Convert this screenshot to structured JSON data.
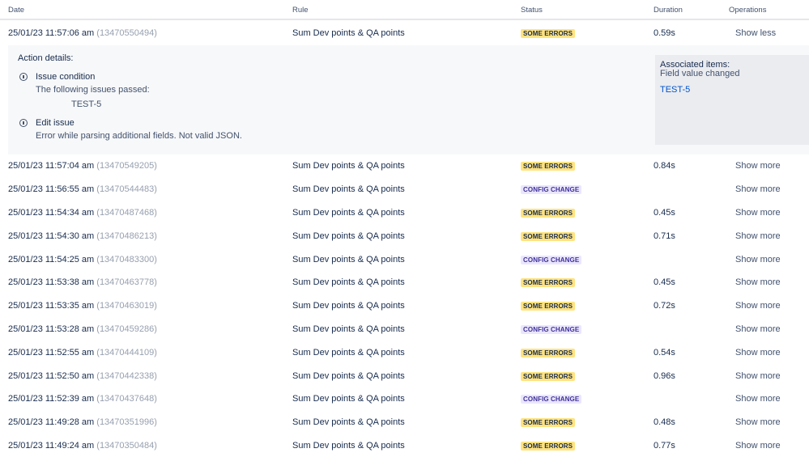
{
  "headers": {
    "date": "Date",
    "rule": "Rule",
    "status": "Status",
    "duration": "Duration",
    "operations": "Operations"
  },
  "expanded_row": {
    "date": "25/01/23 11:57:06 am",
    "id": "(13470550494)",
    "rule": "Sum Dev points & QA points",
    "status": "SOME ERRORS",
    "duration": "0.59s",
    "operation": "Show less"
  },
  "details": {
    "title": "Action details:",
    "actions": [
      {
        "name": "Issue condition",
        "description": "The following issues passed:",
        "issue": "TEST-5"
      },
      {
        "name": "Edit issue",
        "description": "Error while parsing additional fields. Not valid JSON."
      }
    ],
    "associated": {
      "heading": "Associated items:",
      "subheading": "Field value changed",
      "link": "TEST-5"
    }
  },
  "rows": [
    {
      "date": "25/01/23 11:57:04 am",
      "id": "(13470549205)",
      "rule": "Sum Dev points & QA points",
      "status": "SOME ERRORS",
      "status_type": "errors",
      "duration": "0.84s",
      "operation": "Show more"
    },
    {
      "date": "25/01/23 11:56:55 am",
      "id": "(13470544483)",
      "rule": "Sum Dev points & QA points",
      "status": "CONFIG CHANGE",
      "status_type": "config",
      "duration": "",
      "operation": "Show more"
    },
    {
      "date": "25/01/23 11:54:34 am",
      "id": "(13470487468)",
      "rule": "Sum Dev points & QA points",
      "status": "SOME ERRORS",
      "status_type": "errors",
      "duration": "0.45s",
      "operation": "Show more"
    },
    {
      "date": "25/01/23 11:54:30 am",
      "id": "(13470486213)",
      "rule": "Sum Dev points & QA points",
      "status": "SOME ERRORS",
      "status_type": "errors",
      "duration": "0.71s",
      "operation": "Show more"
    },
    {
      "date": "25/01/23 11:54:25 am",
      "id": "(13470483300)",
      "rule": "Sum Dev points & QA points",
      "status": "CONFIG CHANGE",
      "status_type": "config",
      "duration": "",
      "operation": "Show more"
    },
    {
      "date": "25/01/23 11:53:38 am",
      "id": "(13470463778)",
      "rule": "Sum Dev points & QA points",
      "status": "SOME ERRORS",
      "status_type": "errors",
      "duration": "0.45s",
      "operation": "Show more"
    },
    {
      "date": "25/01/23 11:53:35 am",
      "id": "(13470463019)",
      "rule": "Sum Dev points & QA points",
      "status": "SOME ERRORS",
      "status_type": "errors",
      "duration": "0.72s",
      "operation": "Show more"
    },
    {
      "date": "25/01/23 11:53:28 am",
      "id": "(13470459286)",
      "rule": "Sum Dev points & QA points",
      "status": "CONFIG CHANGE",
      "status_type": "config",
      "duration": "",
      "operation": "Show more"
    },
    {
      "date": "25/01/23 11:52:55 am",
      "id": "(13470444109)",
      "rule": "Sum Dev points & QA points",
      "status": "SOME ERRORS",
      "status_type": "errors",
      "duration": "0.54s",
      "operation": "Show more"
    },
    {
      "date": "25/01/23 11:52:50 am",
      "id": "(13470442338)",
      "rule": "Sum Dev points & QA points",
      "status": "SOME ERRORS",
      "status_type": "errors",
      "duration": "0.96s",
      "operation": "Show more"
    },
    {
      "date": "25/01/23 11:52:39 am",
      "id": "(13470437648)",
      "rule": "Sum Dev points & QA points",
      "status": "CONFIG CHANGE",
      "status_type": "config",
      "duration": "",
      "operation": "Show more"
    },
    {
      "date": "25/01/23 11:49:28 am",
      "id": "(13470351996)",
      "rule": "Sum Dev points & QA points",
      "status": "SOME ERRORS",
      "status_type": "errors",
      "duration": "0.48s",
      "operation": "Show more"
    },
    {
      "date": "25/01/23 11:49:24 am",
      "id": "(13470350484)",
      "rule": "Sum Dev points & QA points",
      "status": "SOME ERRORS",
      "status_type": "errors",
      "duration": "0.77s",
      "operation": "Show more"
    }
  ]
}
